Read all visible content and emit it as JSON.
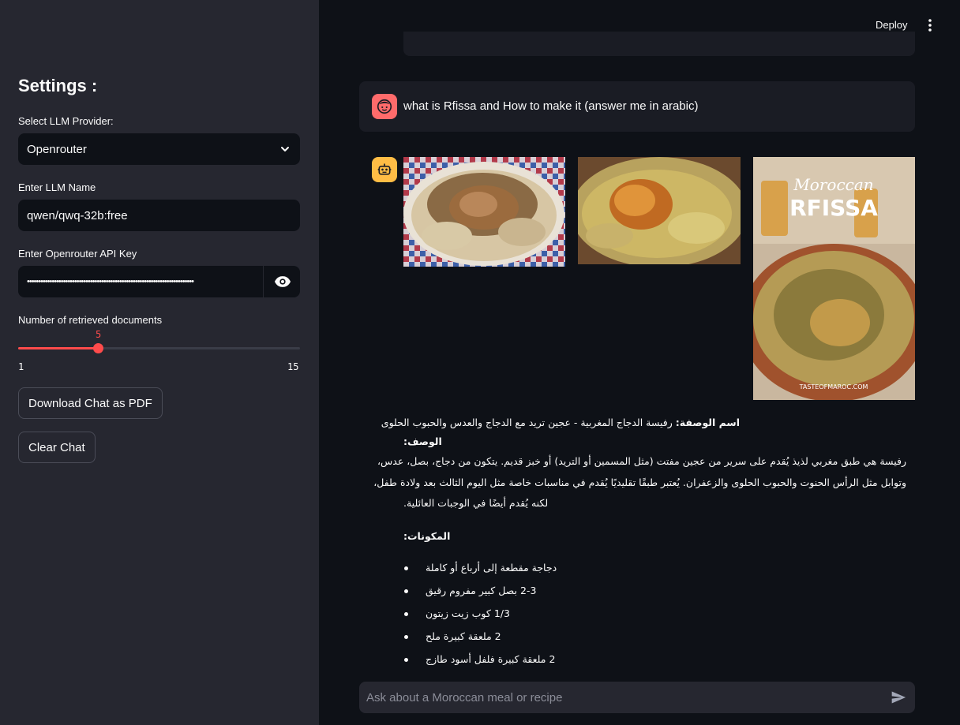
{
  "sidebar": {
    "title": "Settings :",
    "provider_label": "Select LLM Provider:",
    "provider_value": "Openrouter",
    "llm_name_label": "Enter LLM Name",
    "llm_name_value": "qwen/qwq-32b:free",
    "api_key_label": "Enter Openrouter API Key",
    "api_key_value": "••••••••••••••••••••••••••••••••••••••••••••••••••••••••••••••••••••••••••",
    "slider_label": "Number of retrieved documents",
    "slider_value": "5",
    "slider_min": "1",
    "slider_max": "15",
    "slider_fraction": 0.2857,
    "download_button": "Download Chat as PDF",
    "clear_button": "Clear Chat"
  },
  "header": {
    "deploy_label": "Deploy"
  },
  "chat": {
    "user_message": "what is Rfissa and How to make it (answer me in arabic)",
    "images": [
      {
        "name": "rfissa-photo-1"
      },
      {
        "name": "rfissa-photo-2"
      },
      {
        "name": "rfissa-poster",
        "title_line1": "Moroccan",
        "title_line2": "RFISSA",
        "footer": "TASTEOFMAROC.COM"
      }
    ],
    "recipe": {
      "name_label": "اسم الوصفة:",
      "name_value": " رفيسة الدجاج المغربية - عجين تريد مع الدجاج والعدس والحبوب الحلوى",
      "desc_heading": "الوصف:",
      "desc_line1": "رفيسة هي طبق مغربي لذيذ يُقدم على سرير من عجين مفتت (مثل المسمين أو التريد) أو خبز قديم. يتكون من دجاج، بصل، عدس،",
      "desc_line2": "وتوابل مثل الرأس الحنوت والحبوب الحلوى والزعفران. يُعتبر طبقًا تقليديًا يُقدم في مناسبات خاصة مثل اليوم الثالث بعد ولادة طفل،",
      "desc_line3": "لكنه يُقدم أيضًا في الوجبات العائلية.",
      "ingredients_heading": "المكونات:",
      "ingredients": [
        "دجاجة مقطعة إلى أرباع أو كاملة",
        "2-3 بصل كبير مفروم رقيق",
        "1/3 كوب زيت زيتون",
        "2 ملعقة كبيرة ملح",
        "2 ملعقة كبيرة فلفل أسود طازج"
      ]
    }
  },
  "input": {
    "placeholder": "Ask about a Moroccan meal or recipe"
  },
  "colors": {
    "accent": "#ff4b4b",
    "sidebar_bg": "#262730",
    "main_bg": "#0e1117",
    "user_avatar": "#ff6b6b",
    "bot_avatar": "#ffbd45"
  }
}
